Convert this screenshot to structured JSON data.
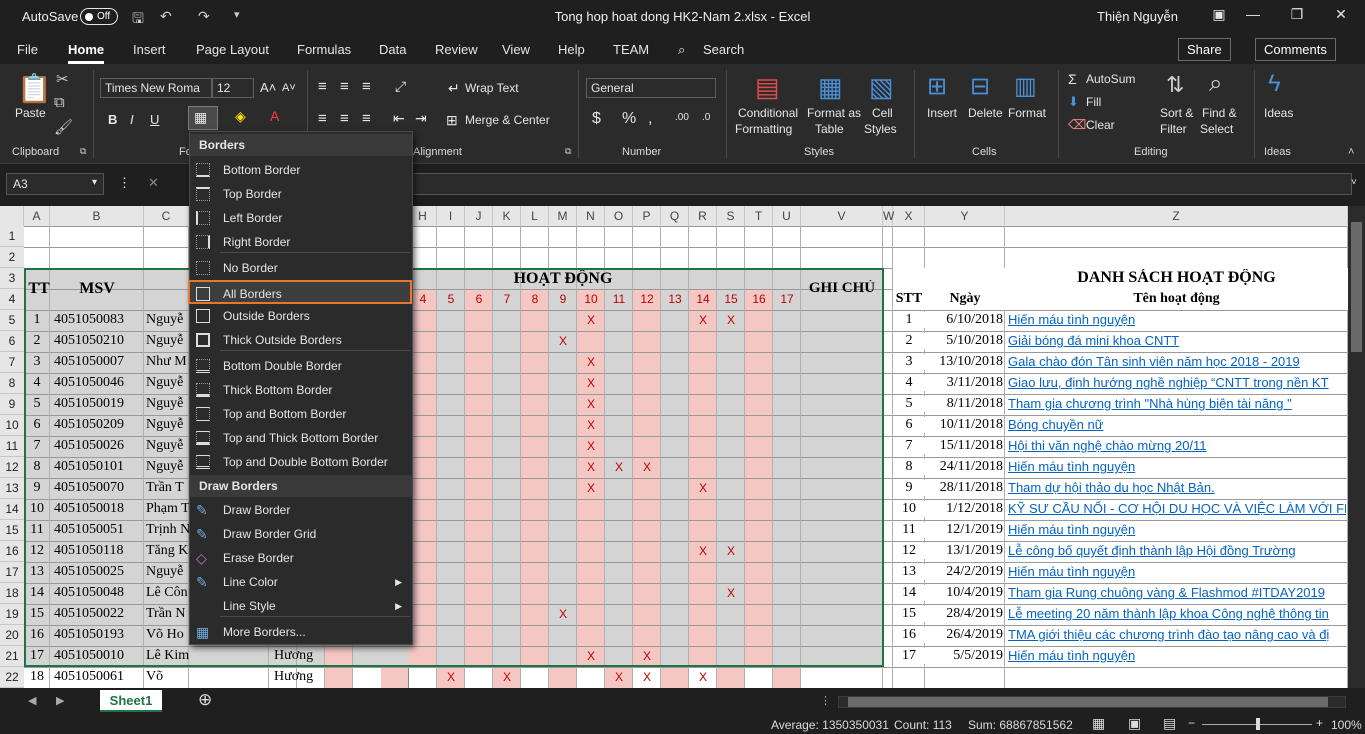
{
  "titlebar": {
    "autosave_label": "AutoSave",
    "autosave_state": "Off",
    "title": "Tong hop hoat dong HK2-Nam 2.xlsx  -  Excel",
    "user": "Thiện Nguyễn"
  },
  "menu": [
    "File",
    "Home",
    "Insert",
    "Page Layout",
    "Formulas",
    "Data",
    "Review",
    "View",
    "Help",
    "TEAM",
    "Search"
  ],
  "share_label": "Share",
  "comments_label": "Comments",
  "ribbon": {
    "paste": "Paste",
    "clipboard": "Clipboard",
    "font_name": "Times New Roma",
    "font_size": "12",
    "font_group": "Fo",
    "alignment_group": "Alignment",
    "wrap_text": "Wrap Text",
    "merge_center": "Merge & Center",
    "number_format": "General",
    "number_group": "Number",
    "conditional_formatting": [
      "Conditional",
      "Formatting"
    ],
    "format_as_table": [
      "Format as",
      "Table"
    ],
    "cell_styles": [
      "Cell",
      "Styles"
    ],
    "styles_group": "Styles",
    "insert": "Insert",
    "delete": "Delete",
    "format": "Format",
    "cells_group": "Cells",
    "autosum": "AutoSum",
    "fill": "Fill",
    "clear": "Clear",
    "sort_filter": [
      "Sort &",
      "Filter"
    ],
    "find_select": [
      "Find &",
      "Select"
    ],
    "editing_group": "Editing",
    "ideas": "Ideas",
    "ideas_group": "Ideas"
  },
  "namebox": "A3",
  "columns": [
    "A",
    "B",
    "C",
    "D",
    "E",
    "F",
    "G",
    "H",
    "I",
    "J",
    "K",
    "L",
    "M",
    "N",
    "O",
    "P",
    "Q",
    "R",
    "S",
    "T",
    "U",
    "V",
    "W",
    "X",
    "Y",
    "Z"
  ],
  "rows": [
    "1",
    "2",
    "3",
    "4",
    "5",
    "6",
    "7",
    "8",
    "9",
    "10",
    "11",
    "12",
    "13",
    "14",
    "15",
    "16",
    "17",
    "18",
    "19",
    "20",
    "21",
    "22"
  ],
  "sheet": {
    "tt_header": "TT",
    "msv_header": "MSV",
    "hoat_dong_header": "HOẠT ĐỘNG",
    "ghi_chu_header": "GHI CHÚ",
    "activity_numbers": [
      "4",
      "5",
      "6",
      "7",
      "8",
      "9",
      "10",
      "11",
      "12",
      "13",
      "14",
      "15",
      "16",
      "17"
    ],
    "students": [
      {
        "tt": "1",
        "msv": "4051050083",
        "name": "Nguyễ"
      },
      {
        "tt": "2",
        "msv": "4051050210",
        "name": "Nguyễ"
      },
      {
        "tt": "3",
        "msv": "4051050007",
        "name": "Như M"
      },
      {
        "tt": "4",
        "msv": "4051050046",
        "name": "Nguyễ"
      },
      {
        "tt": "5",
        "msv": "4051050019",
        "name": "Nguyễ"
      },
      {
        "tt": "6",
        "msv": "4051050209",
        "name": "Nguyễ"
      },
      {
        "tt": "7",
        "msv": "4051050026",
        "name": "Nguyễ"
      },
      {
        "tt": "8",
        "msv": "4051050101",
        "name": "Nguyễ"
      },
      {
        "tt": "9",
        "msv": "4051050070",
        "name": "Trần T"
      },
      {
        "tt": "10",
        "msv": "4051050018",
        "name": "Phạm T"
      },
      {
        "tt": "11",
        "msv": "4051050051",
        "name": "Trịnh N"
      },
      {
        "tt": "12",
        "msv": "4051050118",
        "name": "Tăng K"
      },
      {
        "tt": "13",
        "msv": "4051050025",
        "name": "Nguyễ"
      },
      {
        "tt": "14",
        "msv": "4051050048",
        "name": "Lê Côn"
      },
      {
        "tt": "15",
        "msv": "4051050022",
        "name": "Trần N"
      },
      {
        "tt": "16",
        "msv": "4051050193",
        "name": "Võ Ho"
      },
      {
        "tt": "17",
        "msv": "4051050010",
        "name": "Lê Kim",
        "given": "Hương"
      },
      {
        "tt": "18",
        "msv": "4051050061",
        "name": "Võ",
        "given": "Hương"
      }
    ],
    "x_marks": [
      {
        "row": 0,
        "col": 10
      },
      {
        "row": 0,
        "col": 14
      },
      {
        "row": 0,
        "col": 15
      },
      {
        "row": 1,
        "col": 9
      },
      {
        "row": 2,
        "col": 10
      },
      {
        "row": 3,
        "col": 10
      },
      {
        "row": 4,
        "col": 10
      },
      {
        "row": 5,
        "col": 10
      },
      {
        "row": 6,
        "col": 10
      },
      {
        "row": 7,
        "col": 10
      },
      {
        "row": 7,
        "col": 11
      },
      {
        "row": 7,
        "col": 12
      },
      {
        "row": 8,
        "col": 10
      },
      {
        "row": 8,
        "col": 14
      },
      {
        "row": 11,
        "col": 14
      },
      {
        "row": 11,
        "col": 15
      },
      {
        "row": 13,
        "col": 15
      },
      {
        "row": 14,
        "col": 9
      },
      {
        "row": 16,
        "col": 10
      },
      {
        "row": 16,
        "col": 12
      },
      {
        "row": 17,
        "col": 5
      },
      {
        "row": 17,
        "col": 7
      },
      {
        "row": 17,
        "col": 11
      },
      {
        "row": 17,
        "col": 12
      },
      {
        "row": 17,
        "col": 14
      }
    ],
    "list_title": "DANH SÁCH HOẠT ĐỘNG",
    "stt_header": "STT",
    "date_header": "Ngày",
    "activity_header": "Tên hoạt động",
    "activities": [
      {
        "stt": "1",
        "date": "6/10/2018",
        "name": "Hiến máu tình nguyện"
      },
      {
        "stt": "2",
        "date": "5/10/2018",
        "name": "Giải bóng đá mini khoa CNTT"
      },
      {
        "stt": "3",
        "date": "13/10/2018",
        "name": "Gala chào đón Tân sinh viên năm học 2018 - 2019"
      },
      {
        "stt": "4",
        "date": "3/11/2018",
        "name": "Giao lưu, định hướng nghề nghiệp “CNTT trong nền KT"
      },
      {
        "stt": "5",
        "date": "8/11/2018",
        "name": "Tham gia chương trình \"Nhà hùng biện tài năng \""
      },
      {
        "stt": "6",
        "date": "10/11/2018",
        "name": "Bóng chuyền nữ"
      },
      {
        "stt": "7",
        "date": "15/11/2018",
        "name": "Hội thi văn nghệ chào mừng 20/11"
      },
      {
        "stt": "8",
        "date": "24/11/2018",
        "name": "Hiến máu tình nguyện"
      },
      {
        "stt": "9",
        "date": "28/11/2018",
        "name": "Tham dự hội thảo du học Nhật Bản."
      },
      {
        "stt": "10",
        "date": "1/12/2018",
        "name": "KỸ SƯ CẦU NỐI - CƠ HỘI DU HỌC VÀ VIỆC LÀM VỚI FPT"
      },
      {
        "stt": "11",
        "date": "12/1/2019",
        "name": "Hiến máu tình nguyện"
      },
      {
        "stt": "12",
        "date": "13/1/2019",
        "name": "Lễ công bố quyết định thành lập Hội đồng Trường"
      },
      {
        "stt": "13",
        "date": "24/2/2019",
        "name": "Hiến máu tình nguyện"
      },
      {
        "stt": "14",
        "date": "10/4/2019",
        "name": "Tham gia Rung chuông vàng & Flashmod #ITDAY2019"
      },
      {
        "stt": "15",
        "date": "28/4/2019",
        "name": "Lễ meeting 20 năm thành lập khoa Công nghệ thông tin"
      },
      {
        "stt": "16",
        "date": "26/4/2019",
        "name": "TMA giới thiệu các chương trình đào tạo nâng cao và đị"
      },
      {
        "stt": "17",
        "date": "5/5/2019",
        "name": "Hiến máu tình nguyện"
      }
    ]
  },
  "borders_menu": {
    "header": "Borders",
    "items": [
      "Bottom Border",
      "Top Border",
      "Left Border",
      "Right Border",
      "No Border",
      "All Borders",
      "Outside Borders",
      "Thick Outside Borders",
      "Bottom Double Border",
      "Thick Bottom Border",
      "Top and Bottom Border",
      "Top and Thick Bottom Border",
      "Top and Double Bottom Border"
    ],
    "draw_header": "Draw Borders",
    "draw_items": [
      "Draw Border",
      "Draw Border Grid",
      "Erase Border",
      "Line Color",
      "Line Style",
      "More Borders..."
    ],
    "highlighted": "All Borders"
  },
  "sheet_tab": "Sheet1",
  "status": {
    "average": "Average: 1350350031",
    "count": "Count: 113",
    "sum": "Sum: 68867851562",
    "zoom": "100%"
  },
  "colors": {
    "accent": "#e8762b",
    "pink": "#f4c7c3",
    "link": "#0563c1",
    "sheet_tab": "#217346"
  }
}
